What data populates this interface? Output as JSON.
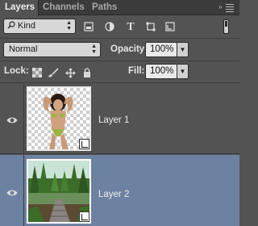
{
  "tabs": [
    {
      "label": "Layers",
      "active": true
    },
    {
      "label": "Channels",
      "active": false
    },
    {
      "label": "Paths",
      "active": false
    }
  ],
  "filter": {
    "kind_label": "Kind",
    "icons": [
      "pixel-filter-icon",
      "adjustment-filter-icon",
      "type-filter-icon",
      "shape-filter-icon",
      "smart-object-filter-icon"
    ]
  },
  "blend": {
    "mode": "Normal",
    "opacity_label": "Opacity:",
    "opacity_value": "100%",
    "fill_label": "Fill:",
    "fill_value": "100%"
  },
  "lock": {
    "label": "Lock:",
    "icons": [
      "lock-transparent-pixels-icon",
      "lock-image-pixels-icon",
      "lock-position-icon",
      "lock-all-icon"
    ]
  },
  "layers": [
    {
      "name": "Layer 1",
      "visible": true,
      "selected": false,
      "smart_object": true
    },
    {
      "name": "Layer 2",
      "visible": true,
      "selected": true,
      "smart_object": true
    }
  ],
  "colors": {
    "panel_bg": "#535353",
    "selected_row": "#6d82a1"
  }
}
